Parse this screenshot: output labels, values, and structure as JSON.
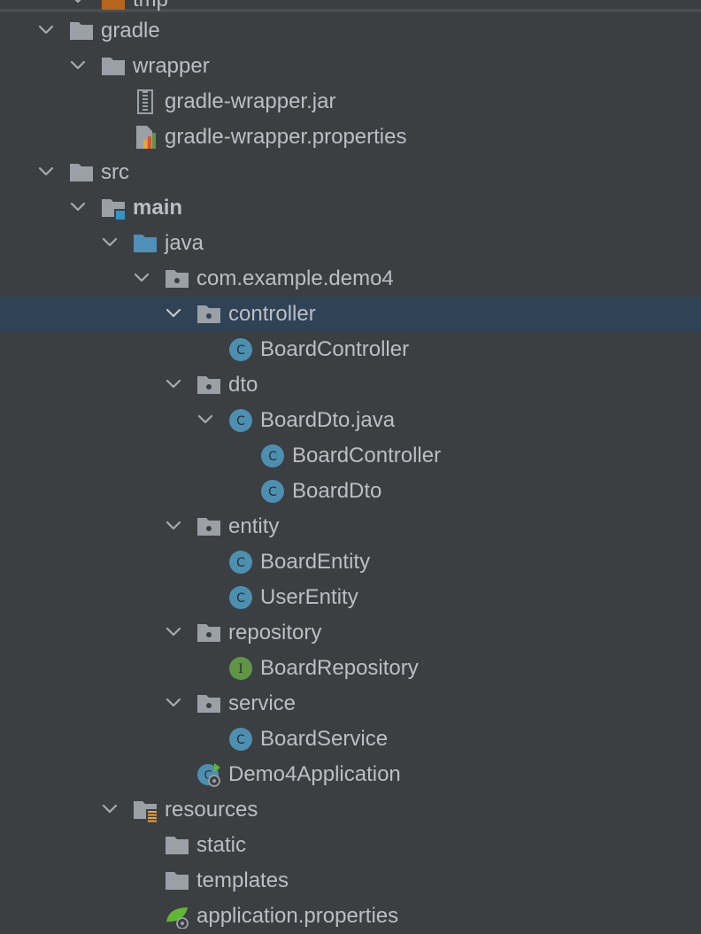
{
  "tree": {
    "top_partial": {
      "label": "tmp"
    },
    "gradle": {
      "label": "gradle"
    },
    "wrapper": {
      "label": "wrapper"
    },
    "wrapper_jar": {
      "label": "gradle-wrapper.jar"
    },
    "wrapper_props": {
      "label": "gradle-wrapper.properties"
    },
    "src": {
      "label": "src"
    },
    "main": {
      "label": "main"
    },
    "java": {
      "label": "java"
    },
    "pkg": {
      "label": "com.example.demo4"
    },
    "controller": {
      "label": "controller"
    },
    "board_controller": {
      "label": "BoardController"
    },
    "dto": {
      "label": "dto"
    },
    "board_dto_java": {
      "label": "BoardDto.java"
    },
    "board_dto_java_controller": {
      "label": "BoardController"
    },
    "board_dto_java_dto": {
      "label": "BoardDto"
    },
    "entity": {
      "label": "entity"
    },
    "board_entity": {
      "label": "BoardEntity"
    },
    "user_entity": {
      "label": "UserEntity"
    },
    "repository": {
      "label": "repository"
    },
    "board_repository": {
      "label": "BoardRepository"
    },
    "service": {
      "label": "service"
    },
    "board_service": {
      "label": "BoardService"
    },
    "demo4_app": {
      "label": "Demo4Application"
    },
    "resources": {
      "label": "resources"
    },
    "static": {
      "label": "static"
    },
    "templates": {
      "label": "templates"
    },
    "app_props": {
      "label": "application.properties"
    }
  },
  "colors": {
    "background": "#3c3f41",
    "selection": "#2f4256",
    "text": "#bcbec4",
    "folder": "#9aa0a6",
    "source_folder": "#4f8fb8",
    "class_icon": "#4d8fb0",
    "interface_icon": "#5f9645"
  }
}
